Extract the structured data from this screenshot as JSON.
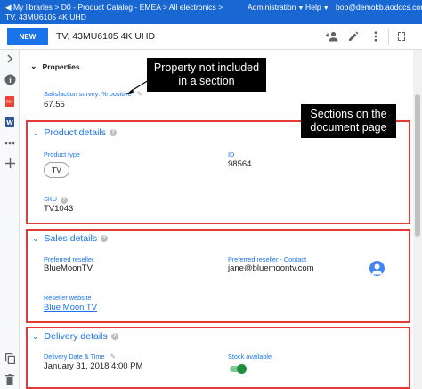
{
  "breadcrumb": {
    "line1": "◀ My libraries  > D0 - Product Catalog - EMEA  >  All electronics  >",
    "line2": "TV, 43MU6105 4K UHD"
  },
  "topnav": {
    "administration": "Administration",
    "help": "Help",
    "user": "bob@demokb.aodocs.com"
  },
  "toolbar": {
    "new_label": "NEW",
    "document_title": "TV, 43MU6105 4K UHD"
  },
  "properties": {
    "title": "Properties",
    "satisfaction_label": "Satisfaction survey: % positive",
    "satisfaction_value": "67.55"
  },
  "product_details": {
    "title": "Product details",
    "product_type_label": "Product type",
    "product_type_value": "TV",
    "id_label": "ID",
    "id_value": "98564",
    "sku_label": "SKU",
    "sku_value": "TV1043"
  },
  "sales_details": {
    "title": "Sales details",
    "preferred_reseller_label": "Preferred reseller",
    "preferred_reseller_value": "BlueMoonTV",
    "contact_label": "Preferred reseller - Contact",
    "contact_value": "jane@bluemoontv.com",
    "website_label": "Reseller website",
    "website_value": "Blue Moon TV"
  },
  "delivery_details": {
    "title": "Delivery details",
    "date_label": "Delivery Date & Time",
    "date_value": "January 31, 2018 4:00 PM",
    "stock_label": "Stock available",
    "stock_available": true
  },
  "annotations": {
    "callout_property": "Property not included in a section",
    "callout_sections": "Sections on the document page"
  },
  "colors": {
    "topbar": "#1967d2",
    "accent": "#1a73e8",
    "highlight_box": "#e53935",
    "toggle_on": "#1e8e3e"
  },
  "icons": [
    "add-person-icon",
    "edit-icon",
    "more-vert-icon",
    "collapse-icon",
    "expand-icon",
    "info-icon",
    "pdf-icon",
    "word-icon",
    "more-horiz-icon",
    "add-icon",
    "copy-icon",
    "delete-icon",
    "edit-pencil-icon",
    "help-icon"
  ]
}
